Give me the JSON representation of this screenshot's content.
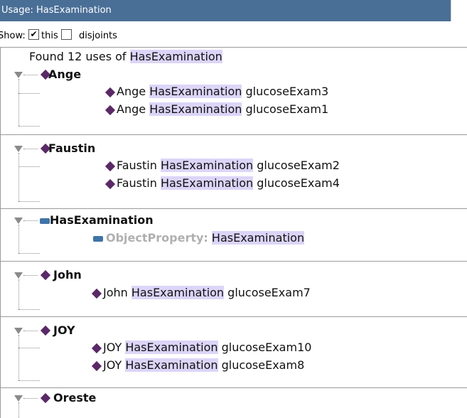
{
  "title": "Usage: HasExamination",
  "show": {
    "label": "Show:",
    "this_label": "this",
    "this_checked": "✔",
    "disjoints_label": "disjoints"
  },
  "found": {
    "prefix": "Found 12 uses of ",
    "term": "HasExamination"
  },
  "groups": [
    {
      "name": "Ange",
      "icon": "diamond",
      "items": [
        {
          "subject": "Ange",
          "property": "HasExamination",
          "object": "glucoseExam3"
        },
        {
          "subject": "Ange",
          "property": "HasExamination",
          "object": "glucoseExam1"
        }
      ]
    },
    {
      "name": "Faustin",
      "icon": "diamond",
      "items": [
        {
          "subject": "Faustin",
          "property": "HasExamination",
          "object": "glucoseExam2"
        },
        {
          "subject": "Faustin",
          "property": "HasExamination",
          "object": "glucoseExam4"
        }
      ]
    },
    {
      "name": "HasExamination",
      "icon": "rect",
      "items": [
        {
          "keyword": "ObjectProperty:",
          "property": "HasExamination"
        }
      ]
    },
    {
      "name": "John",
      "icon": "diamond",
      "items": [
        {
          "subject": "John",
          "property": "HasExamination",
          "object": "glucoseExam7"
        }
      ]
    },
    {
      "name": "JOY",
      "icon": "diamond",
      "items": [
        {
          "subject": "JOY",
          "property": "HasExamination",
          "object": "glucoseExam10"
        },
        {
          "subject": "JOY",
          "property": "HasExamination",
          "object": "glucoseExam8"
        }
      ]
    },
    {
      "name": "Oreste",
      "icon": "diamond",
      "items": []
    }
  ]
}
